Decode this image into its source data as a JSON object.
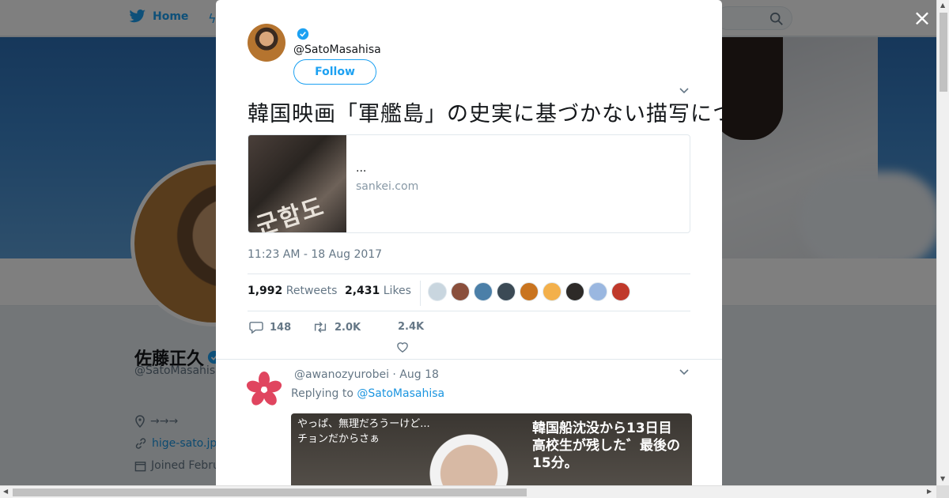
{
  "background": {
    "nav": {
      "home_label": "Home"
    },
    "profile": {
      "name": "佐藤正久",
      "handle": "@SatoMasahisa",
      "location": "→→→",
      "url": "hige-sato.jp",
      "joined": "Joined Febru"
    }
  },
  "modal": {
    "close_label": "×",
    "tweet": {
      "handle": "@SatoMasahisa",
      "follow_label": "Follow",
      "text": "韓国映画「軍艦島」の史実に基づかない描写について、日本政府は毅然とした対応を取るべきだ。反日プロパガンダに対しては、事実に基づいた情報発信が重要。",
      "card": {
        "title": "...",
        "domain": "sankei.com",
        "thumb_text": "군함도"
      },
      "timestamp": "11:23 AM - 18 Aug 2017",
      "retweets_count": "1,992",
      "retweets_label": "Retweets",
      "likes_count": "2,431",
      "likes_label": "Likes",
      "reply_count": "148",
      "retweet_action_count": "2.0K",
      "like_action_count": "2.4K"
    },
    "reply": {
      "header": "@awanozyurobei · Aug 18",
      "replying_to_label": "Replying to",
      "replying_to_handle": "@SatoMasahisa",
      "media_text_left_1": "やっぱ、無理だろうーけど...",
      "media_text_left_2": "チョンだからさぁ",
      "media_text_right_1": "韓国船沈没から13日目",
      "media_text_right_2": "高校生が残した゛最後の15分。"
    }
  },
  "colors": {
    "accent": "#1da1f2",
    "link": "#1b95e0",
    "muted": "#657786",
    "liker_colors": [
      "#c9d6df",
      "#8a4f3c",
      "#4b7fa8",
      "#3b4a55",
      "#c9741f",
      "#f3b04b",
      "#2d2a28",
      "#9ab7e0",
      "#c0392b"
    ]
  }
}
